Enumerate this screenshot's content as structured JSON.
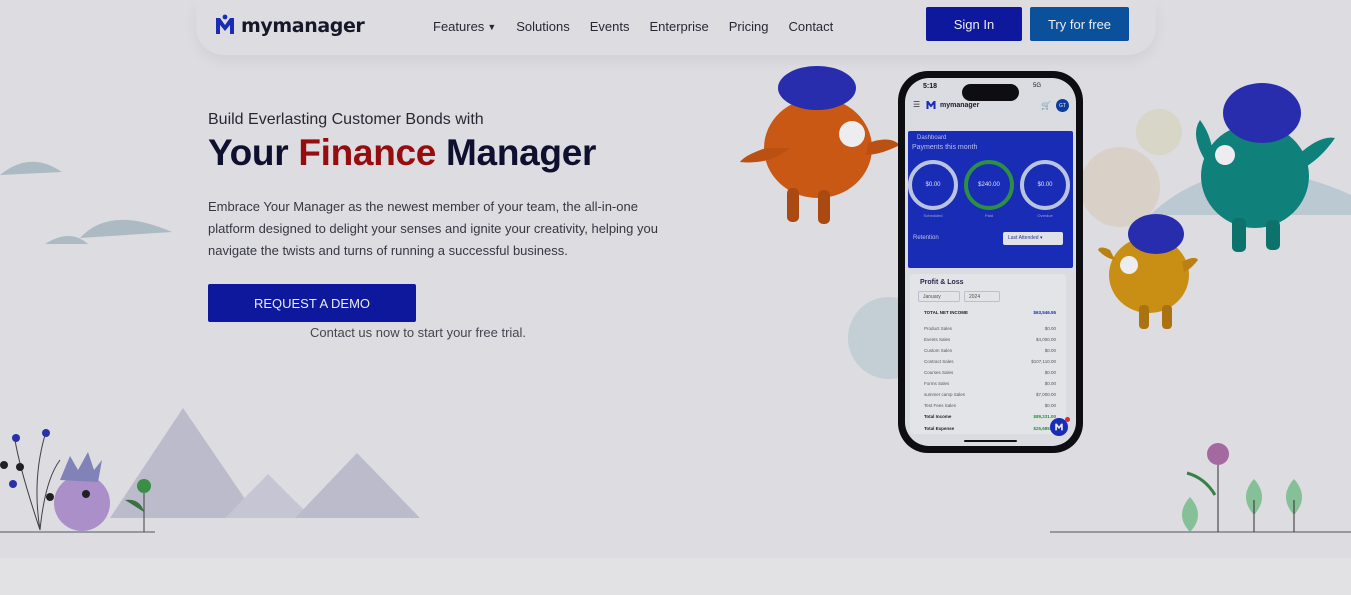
{
  "brand": {
    "name": "mymanager"
  },
  "nav": {
    "links": [
      {
        "label": "Features",
        "has_dropdown": true
      },
      {
        "label": "Solutions"
      },
      {
        "label": "Events"
      },
      {
        "label": "Enterprise"
      },
      {
        "label": "Pricing"
      },
      {
        "label": "Contact"
      }
    ],
    "signin_label": "Sign In",
    "try_label": "Try for free"
  },
  "hero": {
    "subtitle": "Build Everlasting Customer Bonds with",
    "title_part1": "Your",
    "title_accent": "Finance",
    "title_part2": "Manager",
    "description": "Embrace Your Manager as the newest member of your team, the all-in-one platform designed to delight your senses and ignite your creativity, helping you navigate the twists and turns of running a successful business.",
    "cta_label": "REQUEST A DEMO",
    "cta_note": "Contact us now to start your free trial."
  },
  "phone": {
    "time": "5:18",
    "status": "5G",
    "app_name": "mymanager",
    "avatar": "GT",
    "dashboard": {
      "title": "Dashboard",
      "subtitle": "Payments this month",
      "rings": [
        {
          "value": "$0.00",
          "caption": "Scheduled"
        },
        {
          "value": "$240.00",
          "caption": "Paid"
        },
        {
          "value": "$0.00",
          "caption": "Overdue"
        }
      ],
      "retention_label": "Retention",
      "retention_select": "Last Attended"
    },
    "profit_loss": {
      "title": "Profit & Loss",
      "month": "January",
      "year": "2024",
      "net_income_label": "TOTAL NET INCOME",
      "net_income_value": "$63,546.55",
      "rows": [
        {
          "label": "Product Sales",
          "value": "$0.00"
        },
        {
          "label": "Events Sales",
          "value": "$4,000.00"
        },
        {
          "label": "Custom Sales",
          "value": "$0.00"
        },
        {
          "label": "Contract Sales",
          "value": "$107,110.00"
        },
        {
          "label": "Courses Sales",
          "value": "$0.00"
        },
        {
          "label": "Forms Sales",
          "value": "$0.00"
        },
        {
          "label": "summer camp Sales",
          "value": "$7,000.00"
        },
        {
          "label": "Test Fees Sales",
          "value": "$0.00"
        }
      ],
      "total_income_label": "Total Income",
      "total_income_value": "$89,231.00",
      "total_expense_label": "Total Expense",
      "total_expense_value": "$25,685.45"
    }
  },
  "colors": {
    "primary_button": "#0c18a6",
    "secondary_button": "#0a55a4",
    "accent_text": "#a10c0c",
    "title_text": "#0f1030"
  }
}
